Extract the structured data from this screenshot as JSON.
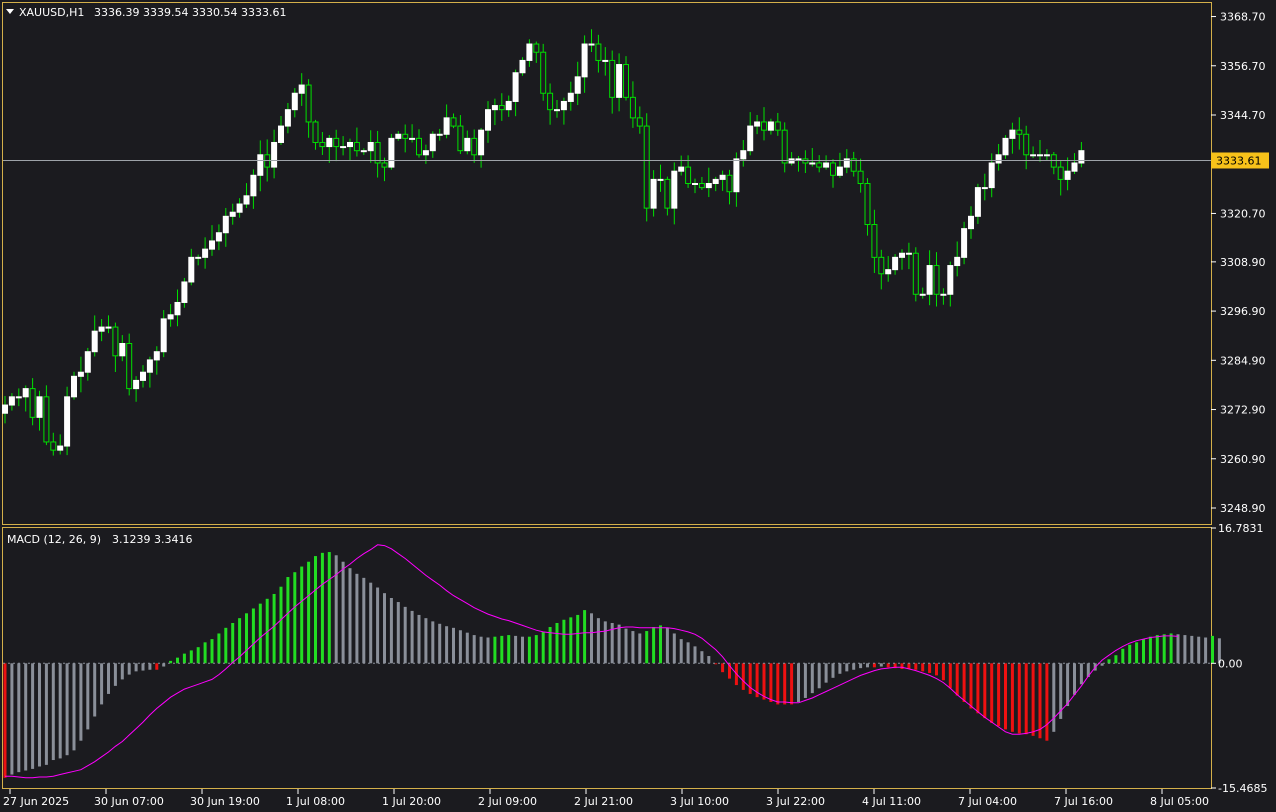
{
  "header": {
    "symbol_label": "XAUUSD,H1",
    "ohlc": "3336.39 3339.54 3330.54 3333.61",
    "indicator_label": "MACD (12, 26, 9)",
    "indicator_values": "3.1239 3.3416"
  },
  "colors": {
    "background": "#1b1b1f",
    "frame": "#d4b04a",
    "bull_body": "#ffffff",
    "bear_body": "#1b1b1f",
    "wick": "#00e000",
    "hist_green": "#22dd22",
    "hist_gray": "#8a8f99",
    "hist_red": "#ee1111",
    "signal": "#ff00ff",
    "price_line": "#9ea3a8",
    "price_tag": "#f7c21a"
  },
  "chart_data": [
    {
      "type": "candlestick",
      "title": "XAUUSD,H1",
      "current_price": 3333.61,
      "current_price_label": "3333.61",
      "ylim": [
        3245.0,
        3372.0
      ],
      "y_ticks": [
        "3368.70",
        "3356.70",
        "3344.70",
        "3332.70",
        "3320.70",
        "3308.90",
        "3296.90",
        "3284.90",
        "3272.90",
        "3260.90",
        "3248.90"
      ],
      "x_ticks": [
        "27 Jun 2025",
        "30 Jun 07:00",
        "30 Jun 19:00",
        "1 Jul 08:00",
        "1 Jul 20:00",
        "2 Jul 09:00",
        "2 Jul 21:00",
        "3 Jul 10:00",
        "3 Jul 22:00",
        "4 Jul 11:00",
        "7 Jul 04:00",
        "7 Jul 16:00",
        "8 Jul 05:00"
      ],
      "closes": [
        3274,
        3276,
        3276,
        3278,
        3271,
        3276,
        3265,
        3263,
        3264,
        3276,
        3281,
        3282,
        3287,
        3292,
        3293,
        3293,
        3286,
        3289,
        3278,
        3280,
        3282,
        3285,
        3287,
        3295,
        3296,
        3299,
        3304,
        3310,
        3310,
        3312,
        3314,
        3316,
        3320,
        3321,
        3323,
        3325,
        3330,
        3335,
        3332,
        3338,
        3342,
        3346,
        3350,
        3352,
        3343,
        3338,
        3337,
        3339,
        3337,
        3337,
        3338,
        3336,
        3336,
        3338,
        3333,
        3332,
        3339,
        3340,
        3339,
        3339,
        3335,
        3336,
        3340,
        3340,
        3344,
        3342,
        3336,
        3339,
        3335,
        3341,
        3346,
        3347,
        3346,
        3348,
        3355,
        3358,
        3362,
        3360,
        3350,
        3346,
        3346,
        3348,
        3350,
        3354,
        3362,
        3362,
        3358,
        3358,
        3349,
        3357,
        3349,
        3344,
        3342,
        3322,
        3329,
        3329,
        3322,
        3331,
        3332,
        3328,
        3328,
        3327,
        3328,
        3329,
        3330,
        3326,
        3334,
        3336,
        3342,
        3343,
        3341,
        3343,
        3341,
        3333,
        3334,
        3334,
        3333,
        3333,
        3332,
        3333,
        3330,
        3332,
        3334,
        3331,
        3328,
        3318,
        3310,
        3306,
        3307,
        3310,
        3311,
        3311,
        3301,
        3301,
        3308,
        3301,
        3301,
        3308,
        3310,
        3317,
        3320,
        3327,
        3327,
        3333,
        3335,
        3339,
        3341,
        3340,
        3335,
        3335,
        3335,
        3335,
        3332,
        3329,
        3331,
        3333,
        3336
      ]
    },
    {
      "type": "bar",
      "title": "MACD (12, 26, 9)",
      "macd_value": 3.1239,
      "signal_value": 3.3416,
      "ylim": [
        -15.4685,
        16.7831
      ],
      "y_ticks": [
        "16.7831",
        "0.00",
        "-15.4685"
      ],
      "legend": "none",
      "series": [
        {
          "name": "MACD",
          "values": [
            -14.2,
            -13.8,
            -13.5,
            -13.3,
            -13.1,
            -12.8,
            -12.6,
            -12.0,
            -11.8,
            -11.4,
            -10.8,
            -9.6,
            -8.2,
            -6.6,
            -5.1,
            -3.8,
            -2.8,
            -2.0,
            -1.4,
            -1.0,
            -0.9,
            -0.8,
            -0.8,
            -0.4,
            0.3,
            0.7,
            1.2,
            1.6,
            2.0,
            2.6,
            3.0,
            3.7,
            4.4,
            5.0,
            5.6,
            6.2,
            6.8,
            7.4,
            8.0,
            8.6,
            9.5,
            10.7,
            11.3,
            12.0,
            12.6,
            13.3,
            13.7,
            13.8,
            13.4,
            12.6,
            11.8,
            11.1,
            10.6,
            10.0,
            9.4,
            8.7,
            8.1,
            7.6,
            7.0,
            6.5,
            6.0,
            5.6,
            5.2,
            4.9,
            4.6,
            4.4,
            4.1,
            3.8,
            3.5,
            3.3,
            3.2,
            3.3,
            3.4,
            3.5,
            3.4,
            3.3,
            3.3,
            3.5,
            3.9,
            4.5,
            5.0,
            5.4,
            5.7,
            6.0,
            6.6,
            6.2,
            5.6,
            5.2,
            5.0,
            4.8,
            4.3,
            4.0,
            3.7,
            4.0,
            4.5,
            4.7,
            4.4,
            3.7,
            3.0,
            2.6,
            2.1,
            1.5,
            0.9,
            -0.1,
            -1.1,
            -1.9,
            -2.7,
            -3.3,
            -3.8,
            -4.2,
            -4.5,
            -4.8,
            -5.1,
            -5.1,
            -5.1,
            -4.8,
            -4.3,
            -3.7,
            -3.1,
            -2.4,
            -1.8,
            -1.3,
            -1.0,
            -0.8,
            -0.6,
            -0.5,
            -0.5,
            -0.4,
            -0.5,
            -0.6,
            -0.7,
            -0.7,
            -0.8,
            -1.0,
            -1.2,
            -1.5,
            -2.1,
            -3.1,
            -4.0,
            -4.8,
            -5.6,
            -6.2,
            -6.8,
            -7.4,
            -7.8,
            -8.2,
            -8.5,
            -8.7,
            -8.8,
            -9.0,
            -9.3,
            -9.6,
            -8.5,
            -6.9,
            -5.3,
            -3.9,
            -2.6,
            -1.7,
            -0.9,
            -0.3,
            0.5,
            1.0,
            1.8,
            2.3,
            2.6,
            3.0,
            3.3,
            3.5,
            3.6,
            3.7,
            3.6,
            3.5,
            3.4,
            3.3,
            3.2,
            3.4,
            3.1
          ]
        },
        {
          "name": "Signal",
          "values": [
            -14.0,
            -14.0,
            -14.1,
            -14.2,
            -14.2,
            -14.1,
            -14.1,
            -14.0,
            -13.8,
            -13.6,
            -13.4,
            -13.2,
            -12.7,
            -12.2,
            -11.6,
            -11.0,
            -10.3,
            -9.7,
            -8.9,
            -8.1,
            -7.3,
            -6.4,
            -5.6,
            -4.9,
            -4.2,
            -3.7,
            -3.2,
            -2.9,
            -2.6,
            -2.3,
            -2.0,
            -1.4,
            -0.7,
            0.1,
            0.8,
            1.6,
            2.4,
            3.2,
            3.9,
            4.6,
            5.4,
            6.2,
            7.0,
            7.7,
            8.4,
            9.1,
            9.8,
            10.4,
            11.0,
            11.7,
            12.3,
            13.0,
            13.6,
            14.1,
            14.7,
            14.6,
            14.2,
            13.6,
            13.0,
            12.3,
            11.6,
            10.9,
            10.3,
            9.7,
            9.0,
            8.4,
            7.9,
            7.4,
            6.9,
            6.5,
            6.1,
            5.8,
            5.5,
            5.3,
            5.0,
            4.7,
            4.4,
            4.1,
            3.9,
            3.8,
            3.7,
            3.6,
            3.6,
            3.7,
            3.8,
            3.8,
            3.9,
            4.0,
            4.2,
            4.4,
            4.5,
            4.5,
            4.4,
            4.4,
            4.4,
            4.4,
            4.4,
            4.3,
            4.1,
            3.9,
            3.6,
            3.1,
            2.4,
            1.7,
            0.8,
            -0.3,
            -1.3,
            -2.2,
            -3.0,
            -3.6,
            -4.1,
            -4.5,
            -4.8,
            -4.8,
            -4.9,
            -4.9,
            -4.6,
            -4.3,
            -3.9,
            -3.5,
            -3.1,
            -2.7,
            -2.3,
            -1.9,
            -1.5,
            -1.2,
            -0.9,
            -0.7,
            -0.6,
            -0.5,
            -0.5,
            -0.7,
            -0.9,
            -1.2,
            -1.5,
            -1.9,
            -2.4,
            -3.1,
            -3.9,
            -4.6,
            -5.3,
            -6.0,
            -6.7,
            -7.3,
            -7.9,
            -8.5,
            -8.8,
            -8.8,
            -8.7,
            -8.5,
            -8.2,
            -7.6,
            -6.8,
            -5.9,
            -5.0,
            -3.9,
            -2.8,
            -1.6,
            -0.5,
            0.4,
            1.0,
            1.6,
            2.1,
            2.5,
            2.8,
            3.0,
            3.2,
            3.3,
            3.4,
            3.4,
            3.3416
          ]
        }
      ]
    }
  ]
}
